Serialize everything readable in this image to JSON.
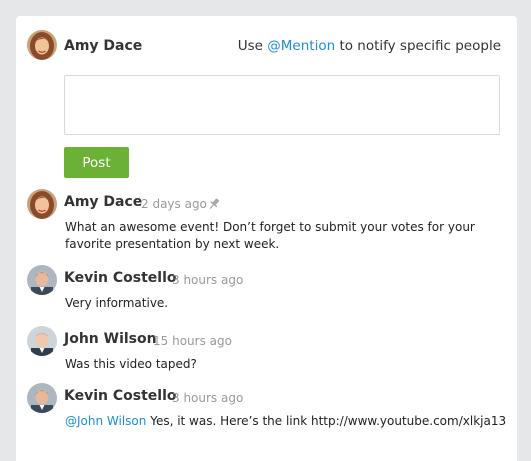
{
  "composer": {
    "user_name": "Amy Dace",
    "hint_prefix": "Use",
    "hint_mention": "@Mention",
    "hint_suffix": "to notify specific people",
    "input_value": "",
    "post_label": "Post"
  },
  "comments": [
    {
      "author": "Amy Dace",
      "time": "2 days ago",
      "pinned": true,
      "mention": "",
      "text": "What an awesome event! Don’t forget to submit your votes for your favorite presentation by next week."
    },
    {
      "author": "Kevin Costello",
      "time": "3 hours ago",
      "mention": "",
      "text": "Very informative."
    },
    {
      "author": "John Wilson",
      "time": "15 hours ago",
      "mention": "",
      "text": "Was this video taped?"
    },
    {
      "author": "Kevin Costello",
      "time": "3 hours ago",
      "mention": "@John Wilson",
      "text": "Yes, it was. Here’s the link http://www.youtube.com/xlkja13"
    }
  ],
  "colors": {
    "accent_link": "#1a8fd5",
    "post_button": "#6ab136",
    "background": "#e6e7e9"
  }
}
